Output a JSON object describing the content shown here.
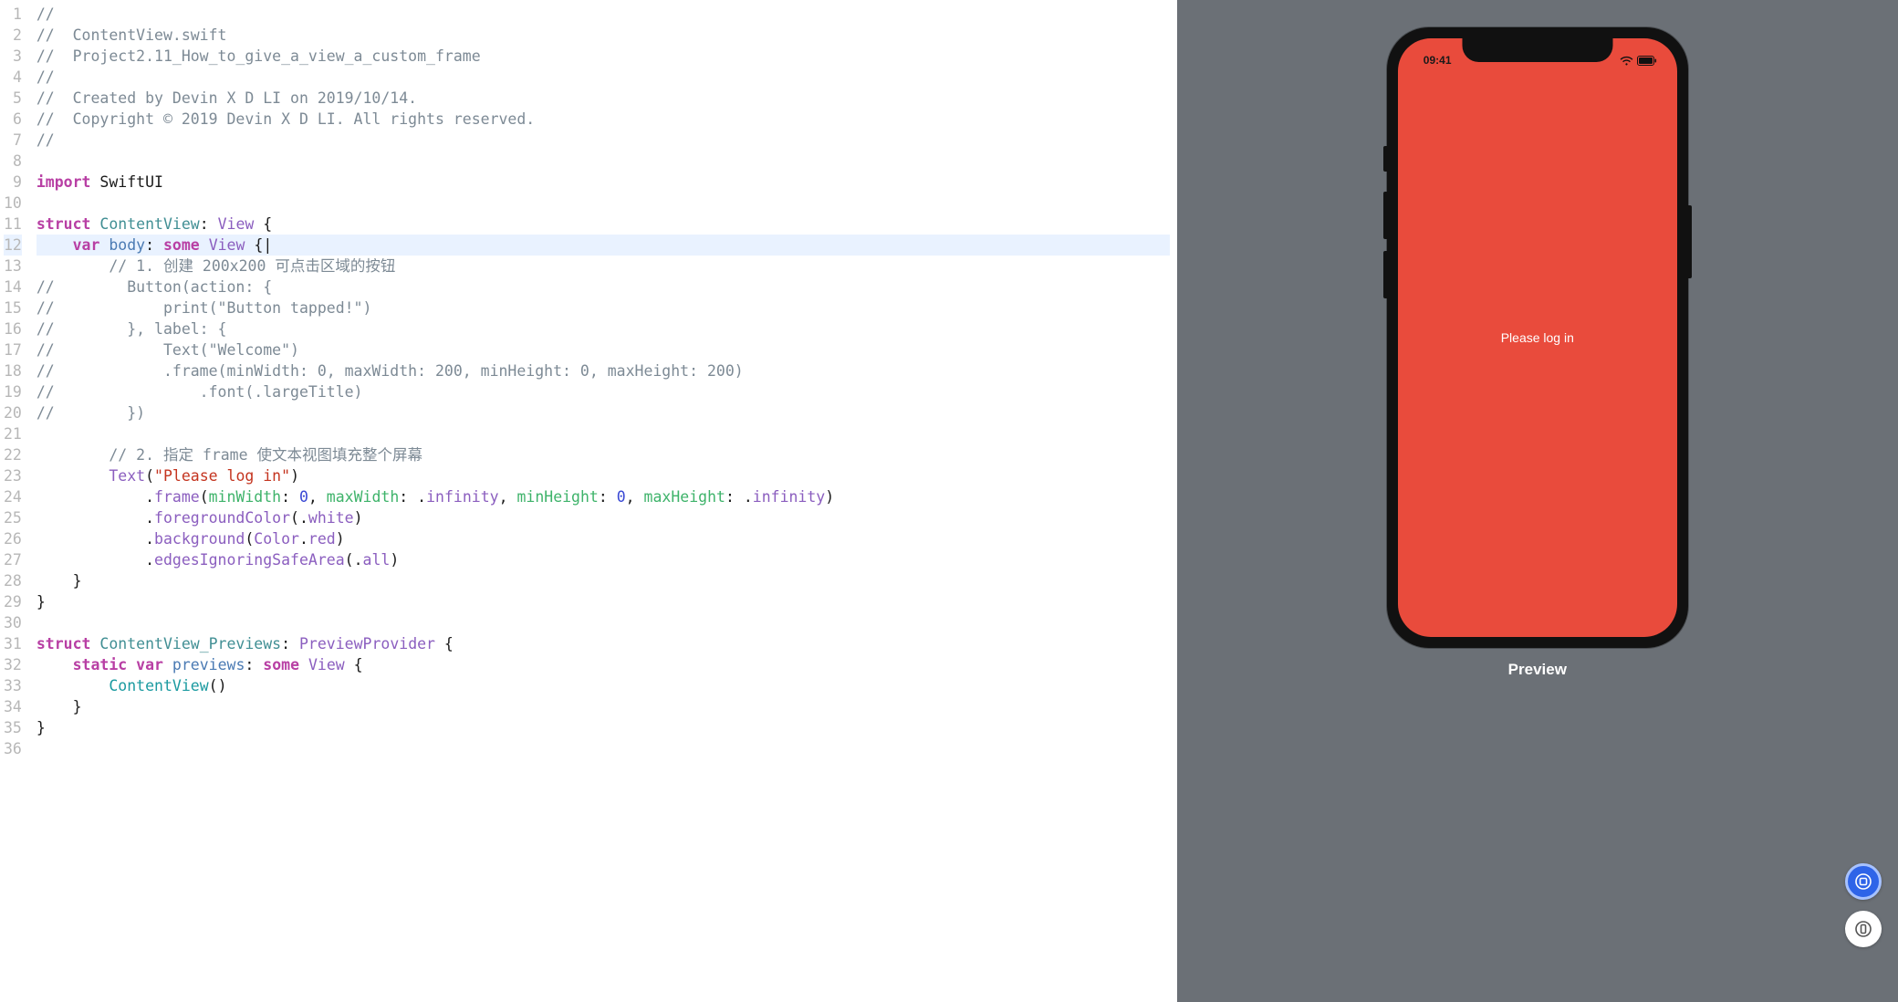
{
  "editor": {
    "currentLine": 12,
    "lines": [
      {
        "n": 1,
        "tokens": [
          {
            "t": "//",
            "c": "comment"
          }
        ]
      },
      {
        "n": 2,
        "tokens": [
          {
            "t": "//  ContentView.swift",
            "c": "comment"
          }
        ]
      },
      {
        "n": 3,
        "tokens": [
          {
            "t": "//  Project2.11_How_to_give_a_view_a_custom_frame",
            "c": "comment"
          }
        ]
      },
      {
        "n": 4,
        "tokens": [
          {
            "t": "//",
            "c": "comment"
          }
        ]
      },
      {
        "n": 5,
        "tokens": [
          {
            "t": "//  Created by Devin X D LI on 2019/10/14.",
            "c": "comment"
          }
        ]
      },
      {
        "n": 6,
        "tokens": [
          {
            "t": "//  Copyright © 2019 Devin X D LI. All rights reserved.",
            "c": "comment"
          }
        ]
      },
      {
        "n": 7,
        "tokens": [
          {
            "t": "//",
            "c": "comment"
          }
        ]
      },
      {
        "n": 8,
        "tokens": []
      },
      {
        "n": 9,
        "tokens": [
          {
            "t": "import",
            "c": "keyword"
          },
          {
            "t": " ",
            "c": "black"
          },
          {
            "t": "SwiftUI",
            "c": "black"
          }
        ]
      },
      {
        "n": 10,
        "tokens": []
      },
      {
        "n": 11,
        "tokens": [
          {
            "t": "struct",
            "c": "keyword"
          },
          {
            "t": " ",
            "c": "black"
          },
          {
            "t": "ContentView",
            "c": "declvar"
          },
          {
            "t": ": ",
            "c": "black"
          },
          {
            "t": "View",
            "c": "purple"
          },
          {
            "t": " {",
            "c": "black"
          }
        ]
      },
      {
        "n": 12,
        "tokens": [
          {
            "t": "    ",
            "c": "black"
          },
          {
            "t": "var",
            "c": "keyword"
          },
          {
            "t": " ",
            "c": "black"
          },
          {
            "t": "body",
            "c": "type"
          },
          {
            "t": ": ",
            "c": "black"
          },
          {
            "t": "some",
            "c": "keyword"
          },
          {
            "t": " ",
            "c": "black"
          },
          {
            "t": "View",
            "c": "purple"
          },
          {
            "t": " {",
            "c": "black"
          }
        ]
      },
      {
        "n": 13,
        "tokens": [
          {
            "t": "        // 1. 创建 200x200 可点击区域的按钮",
            "c": "comment"
          }
        ]
      },
      {
        "n": 14,
        "tokens": [
          {
            "t": "//        Button(action: {",
            "c": "comment"
          }
        ]
      },
      {
        "n": 15,
        "tokens": [
          {
            "t": "//            print(\"Button tapped!\")",
            "c": "comment"
          }
        ]
      },
      {
        "n": 16,
        "tokens": [
          {
            "t": "//        }, label: {",
            "c": "comment"
          }
        ]
      },
      {
        "n": 17,
        "tokens": [
          {
            "t": "//            Text(\"Welcome\")",
            "c": "comment"
          }
        ]
      },
      {
        "n": 18,
        "tokens": [
          {
            "t": "//            .frame(minWidth: 0, maxWidth: 200, minHeight: 0, maxHeight: 200)",
            "c": "comment"
          }
        ]
      },
      {
        "n": 19,
        "tokens": [
          {
            "t": "//                .font(.largeTitle)",
            "c": "comment"
          }
        ]
      },
      {
        "n": 20,
        "tokens": [
          {
            "t": "//        })",
            "c": "comment"
          }
        ]
      },
      {
        "n": 21,
        "tokens": []
      },
      {
        "n": 22,
        "tokens": [
          {
            "t": "        // 2. 指定 frame 使文本视图填充整个屏幕",
            "c": "comment"
          }
        ]
      },
      {
        "n": 23,
        "tokens": [
          {
            "t": "        ",
            "c": "black"
          },
          {
            "t": "Text",
            "c": "purple"
          },
          {
            "t": "(",
            "c": "black"
          },
          {
            "t": "\"Please log in\"",
            "c": "string"
          },
          {
            "t": ")",
            "c": "black"
          }
        ]
      },
      {
        "n": 24,
        "tokens": [
          {
            "t": "            .",
            "c": "black"
          },
          {
            "t": "frame",
            "c": "purple"
          },
          {
            "t": "(",
            "c": "black"
          },
          {
            "t": "minWidth",
            "c": "member"
          },
          {
            "t": ": ",
            "c": "black"
          },
          {
            "t": "0",
            "c": "number"
          },
          {
            "t": ", ",
            "c": "black"
          },
          {
            "t": "maxWidth",
            "c": "member"
          },
          {
            "t": ": .",
            "c": "black"
          },
          {
            "t": "infinity",
            "c": "purple"
          },
          {
            "t": ", ",
            "c": "black"
          },
          {
            "t": "minHeight",
            "c": "member"
          },
          {
            "t": ": ",
            "c": "black"
          },
          {
            "t": "0",
            "c": "number"
          },
          {
            "t": ", ",
            "c": "black"
          },
          {
            "t": "maxHeight",
            "c": "member"
          },
          {
            "t": ": .",
            "c": "black"
          },
          {
            "t": "infinity",
            "c": "purple"
          },
          {
            "t": ")",
            "c": "black"
          }
        ]
      },
      {
        "n": 25,
        "tokens": [
          {
            "t": "            .",
            "c": "black"
          },
          {
            "t": "foregroundColor",
            "c": "purple"
          },
          {
            "t": "(.",
            "c": "black"
          },
          {
            "t": "white",
            "c": "purple"
          },
          {
            "t": ")",
            "c": "black"
          }
        ]
      },
      {
        "n": 26,
        "tokens": [
          {
            "t": "            .",
            "c": "black"
          },
          {
            "t": "background",
            "c": "purple"
          },
          {
            "t": "(",
            "c": "black"
          },
          {
            "t": "Color",
            "c": "purple"
          },
          {
            "t": ".",
            "c": "black"
          },
          {
            "t": "red",
            "c": "purple"
          },
          {
            "t": ")",
            "c": "black"
          }
        ]
      },
      {
        "n": 27,
        "tokens": [
          {
            "t": "            .",
            "c": "black"
          },
          {
            "t": "edgesIgnoringSafeArea",
            "c": "purple"
          },
          {
            "t": "(.",
            "c": "black"
          },
          {
            "t": "all",
            "c": "purple"
          },
          {
            "t": ")",
            "c": "black"
          }
        ]
      },
      {
        "n": 28,
        "tokens": [
          {
            "t": "    }",
            "c": "black"
          }
        ]
      },
      {
        "n": 29,
        "tokens": [
          {
            "t": "}",
            "c": "black"
          }
        ]
      },
      {
        "n": 30,
        "tokens": []
      },
      {
        "n": 31,
        "tokens": [
          {
            "t": "struct",
            "c": "keyword"
          },
          {
            "t": " ",
            "c": "black"
          },
          {
            "t": "ContentView_Previews",
            "c": "declvar"
          },
          {
            "t": ": ",
            "c": "black"
          },
          {
            "t": "PreviewProvider",
            "c": "purple"
          },
          {
            "t": " {",
            "c": "black"
          }
        ]
      },
      {
        "n": 32,
        "tokens": [
          {
            "t": "    ",
            "c": "black"
          },
          {
            "t": "static",
            "c": "keyword"
          },
          {
            "t": " ",
            "c": "black"
          },
          {
            "t": "var",
            "c": "keyword"
          },
          {
            "t": " ",
            "c": "black"
          },
          {
            "t": "previews",
            "c": "type"
          },
          {
            "t": ": ",
            "c": "black"
          },
          {
            "t": "some",
            "c": "keyword"
          },
          {
            "t": " ",
            "c": "black"
          },
          {
            "t": "View",
            "c": "purple"
          },
          {
            "t": " {",
            "c": "black"
          }
        ]
      },
      {
        "n": 33,
        "tokens": [
          {
            "t": "        ",
            "c": "black"
          },
          {
            "t": "ContentView",
            "c": "ident"
          },
          {
            "t": "()",
            "c": "black"
          }
        ]
      },
      {
        "n": 34,
        "tokens": [
          {
            "t": "    }",
            "c": "black"
          }
        ]
      },
      {
        "n": 35,
        "tokens": [
          {
            "t": "}",
            "c": "black"
          }
        ]
      },
      {
        "n": 36,
        "tokens": []
      }
    ]
  },
  "preview": {
    "label": "Preview",
    "status_time": "09:41",
    "screen_text": "Please log in",
    "bg_color": "#e94b3c"
  }
}
